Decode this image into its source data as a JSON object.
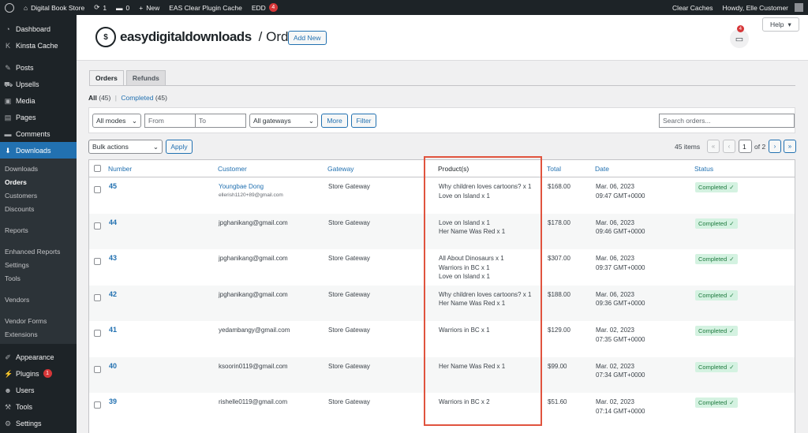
{
  "adminbar": {
    "site_name": "Digital Book Store",
    "updates_count": "1",
    "comments_count": "0",
    "new_label": "New",
    "cache_label": "EAS Clear Plugin Cache",
    "edd_label": "EDD",
    "edd_badge": "4",
    "clear_caches": "Clear Caches",
    "howdy": "Howdy, Elle Customer"
  },
  "sidebar": {
    "top": [
      {
        "label": "Dashboard",
        "icon": "dashboard-icon",
        "glyph": "◔"
      },
      {
        "label": "Kinsta Cache",
        "icon": "kinsta-icon",
        "glyph": "K"
      }
    ],
    "mid": [
      {
        "label": "Posts",
        "icon": "pin-icon",
        "glyph": "✎"
      },
      {
        "label": "Upsells",
        "icon": "cart-icon",
        "glyph": "⛟"
      },
      {
        "label": "Media",
        "icon": "media-icon",
        "glyph": "▣"
      },
      {
        "label": "Pages",
        "icon": "page-icon",
        "glyph": "▤"
      },
      {
        "label": "Comments",
        "icon": "comment-icon",
        "glyph": "▬"
      }
    ],
    "downloads": {
      "label": "Downloads",
      "icon": "download-icon",
      "glyph": "⬇"
    },
    "sub": [
      "Downloads",
      "Orders",
      "Customers",
      "Discounts",
      "Reports",
      "Enhanced Reports",
      "Settings",
      "Tools",
      "Vendors",
      "Vendor Forms",
      "Extensions"
    ],
    "bottom": [
      {
        "label": "Appearance",
        "icon": "brush-icon",
        "glyph": "✐"
      },
      {
        "label": "Plugins",
        "icon": "plugin-icon",
        "glyph": "⚡",
        "badge": "1"
      },
      {
        "label": "Users",
        "icon": "user-icon",
        "glyph": "☻"
      },
      {
        "label": "Tools",
        "icon": "wrench-icon",
        "glyph": "⚒"
      },
      {
        "label": "Settings",
        "icon": "settings-icon",
        "glyph": "⚙"
      }
    ]
  },
  "header": {
    "logo": "easydigitaldownloads",
    "sep": "/",
    "title": "Orders",
    "add_new": "Add New",
    "help": "Help",
    "notif_badge": "4"
  },
  "tabs": [
    "Orders",
    "Refunds"
  ],
  "views": {
    "all": "All",
    "all_count": "(45)",
    "sep": "|",
    "completed": "Completed",
    "completed_count": "(45)"
  },
  "filters": {
    "mode": "All modes",
    "from": "From",
    "to": "To",
    "gateway": "All gateways",
    "more": "More",
    "filter": "Filter",
    "search_placeholder": "Search orders..."
  },
  "tablenav": {
    "bulk": "Bulk actions",
    "apply": "Apply",
    "items": "45 items",
    "page": "1",
    "of": "of 2"
  },
  "columns": [
    "Number",
    "Customer",
    "Gateway",
    "Product(s)",
    "Total",
    "Date",
    "Status"
  ],
  "orders": [
    {
      "number": "45",
      "customer": "Youngbae Dong",
      "email": "ellerish1120+89@gmail.com",
      "gateway": "Store Gateway",
      "products": [
        "Why children loves cartoons? x 1",
        "Love on Island x 1"
      ],
      "total": "$168.00",
      "date": "Mar. 06, 2023",
      "time": "09:47 GMT+0000",
      "status": "Completed"
    },
    {
      "number": "44",
      "customer": "jpghanikang@gmail.com",
      "email": "",
      "gateway": "Store Gateway",
      "products": [
        "Love on Island x 1",
        "Her Name Was Red x 1"
      ],
      "total": "$178.00",
      "date": "Mar. 06, 2023",
      "time": "09:46 GMT+0000",
      "status": "Completed"
    },
    {
      "number": "43",
      "customer": "jpghanikang@gmail.com",
      "email": "",
      "gateway": "Store Gateway",
      "products": [
        "All About Dinosaurs x 1",
        "Warriors in BC x 1",
        "Love on Island x 1"
      ],
      "total": "$307.00",
      "date": "Mar. 06, 2023",
      "time": "09:37 GMT+0000",
      "status": "Completed"
    },
    {
      "number": "42",
      "customer": "jpghanikang@gmail.com",
      "email": "",
      "gateway": "Store Gateway",
      "products": [
        "Why children loves cartoons? x 1",
        "Her Name Was Red x 1"
      ],
      "total": "$188.00",
      "date": "Mar. 06, 2023",
      "time": "09:36 GMT+0000",
      "status": "Completed"
    },
    {
      "number": "41",
      "customer": "yedambangy@gmail.com",
      "email": "",
      "gateway": "Store Gateway",
      "products": [
        "Warriors in BC x 1"
      ],
      "total": "$129.00",
      "date": "Mar. 02, 2023",
      "time": "07:35 GMT+0000",
      "status": "Completed"
    },
    {
      "number": "40",
      "customer": "ksoorin0119@gmail.com",
      "email": "",
      "gateway": "Store Gateway",
      "products": [
        "Her Name Was Red x 1"
      ],
      "total": "$99.00",
      "date": "Mar. 02, 2023",
      "time": "07:34 GMT+0000",
      "status": "Completed"
    },
    {
      "number": "39",
      "customer": "rishelle0119@gmail.com",
      "email": "",
      "gateway": "Store Gateway",
      "products": [
        "Warriors in BC x 2"
      ],
      "total": "$51.60",
      "date": "Mar. 02, 2023",
      "time": "07:14 GMT+0000",
      "status": "Completed"
    }
  ],
  "colors": {
    "accent": "#2271b1",
    "admin_dark": "#1d2327",
    "highlight": "#e0533e",
    "status_bg": "#d4f2e1"
  }
}
